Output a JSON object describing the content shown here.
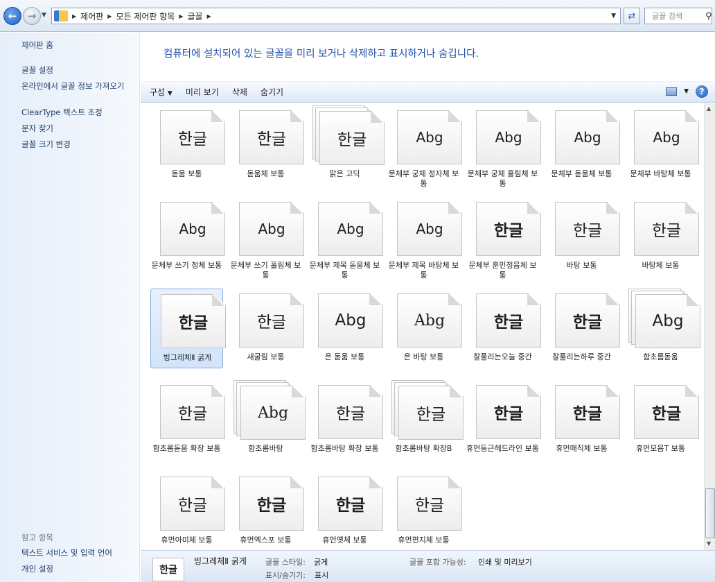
{
  "address": {
    "crumbs": [
      "제어판",
      "모든 제어판 항목",
      "글꼴"
    ],
    "search_placeholder": "글꼴 검색"
  },
  "sidebar": {
    "home": "제어판 홈",
    "links": [
      "글꼴 설정",
      "온라인에서 글꼴 정보 가져오기",
      "ClearType 텍스트 조정",
      "문자 찾기",
      "글꼴 크기 변경"
    ],
    "see_also_header": "참고 항목",
    "see_also": [
      "텍스트 서비스 및 입력 언어",
      "개인 설정"
    ]
  },
  "header_text": "컴퓨터에 설치되어 있는 글꼴을 미리 보거나 삭제하고 표시하거나 숨깁니다.",
  "toolbar": {
    "organize": "구성",
    "preview": "미리 보기",
    "delete": "삭제",
    "hide": "숨기기"
  },
  "fonts": [
    {
      "name": "돋움 보통",
      "sample": "한글",
      "style": "normal",
      "stack": false
    },
    {
      "name": "돋움체 보통",
      "sample": "한글",
      "style": "normal",
      "stack": false
    },
    {
      "name": "맑은 고딕",
      "sample": "한글",
      "style": "normal",
      "stack": true
    },
    {
      "name": "문체부 궁체 정자체 보통",
      "sample": "Abg",
      "style": "abg",
      "stack": false
    },
    {
      "name": "문체부 궁체 흘림체 보통",
      "sample": "Abg",
      "style": "abg",
      "stack": false
    },
    {
      "name": "문체부 돋움체 보통",
      "sample": "Abg",
      "style": "abg",
      "stack": false
    },
    {
      "name": "문체부 바탕체 보통",
      "sample": "Abg",
      "style": "abg",
      "stack": false
    },
    {
      "name": "문체부 쓰기 정체 보통",
      "sample": "Abg",
      "style": "abg",
      "stack": false
    },
    {
      "name": "문체부 쓰기 흘림체 보통",
      "sample": "Abg",
      "style": "abg",
      "stack": false
    },
    {
      "name": "문체부 제목 돋움체 보통",
      "sample": "Abg",
      "style": "abg",
      "stack": false
    },
    {
      "name": "문체부 제목 바탕체 보통",
      "sample": "Abg",
      "style": "abg",
      "stack": false
    },
    {
      "name": "문체부 훈민정음체 보통",
      "sample": "한글",
      "style": "bold",
      "stack": false
    },
    {
      "name": "바탕 보통",
      "sample": "한글",
      "style": "serif",
      "stack": false
    },
    {
      "name": "바탕체 보통",
      "sample": "한글",
      "style": "serif",
      "stack": false
    },
    {
      "name": "빙그레체Ⅱ 굵게",
      "sample": "한글",
      "style": "bold",
      "stack": false
    },
    {
      "name": "새굴림 보통",
      "sample": "한글",
      "style": "normal",
      "stack": false
    },
    {
      "name": "은 돋움 보통",
      "sample": "Abg",
      "style": "abg-big",
      "stack": false
    },
    {
      "name": "은 바탕 보통",
      "sample": "Abg",
      "style": "ser-abg",
      "stack": false
    },
    {
      "name": "잘풀리는오늘 중간",
      "sample": "한글",
      "style": "bold",
      "stack": false
    },
    {
      "name": "잘풀리는하루 중간",
      "sample": "한글",
      "style": "bold",
      "stack": false
    },
    {
      "name": "함초롬돋움",
      "sample": "Abg",
      "style": "abg-big",
      "stack": true
    },
    {
      "name": "함초롬돋움 확장 보통",
      "sample": "한글",
      "style": "normal",
      "stack": false
    },
    {
      "name": "함초롬바탕",
      "sample": "Abg",
      "style": "ser-abg",
      "stack": true
    },
    {
      "name": "함초롬바탕 확장 보통",
      "sample": "한글",
      "style": "serif",
      "stack": false
    },
    {
      "name": "함초롬바탕 확장B",
      "sample": "한글",
      "style": "serif",
      "stack": true
    },
    {
      "name": "휴먼둥근헤드라인 보통",
      "sample": "한글",
      "style": "bold",
      "stack": false
    },
    {
      "name": "휴먼매직체 보통",
      "sample": "한글",
      "style": "bold",
      "stack": false
    },
    {
      "name": "휴먼모음T 보통",
      "sample": "한글",
      "style": "bold",
      "stack": false
    },
    {
      "name": "휴먼아미체 보통",
      "sample": "한글",
      "style": "normal",
      "stack": false
    },
    {
      "name": "휴먼엑스포 보통",
      "sample": "한글",
      "style": "bold",
      "stack": false
    },
    {
      "name": "휴먼옛체 보통",
      "sample": "한글",
      "style": "bold",
      "stack": false
    },
    {
      "name": "휴먼편지체 보통",
      "sample": "한글",
      "style": "serif",
      "stack": false
    }
  ],
  "selected_index": 14,
  "details": {
    "thumb": "한글",
    "name": "빙그레체Ⅱ 굵게",
    "style_label": "글꼴 스타일:",
    "style_value": "굵게",
    "embed_label": "글꼴 포함 가능성:",
    "embed_value": "인쇄 및 미리보기",
    "show_label": "표시/숨기기:",
    "show_value": "표시"
  }
}
